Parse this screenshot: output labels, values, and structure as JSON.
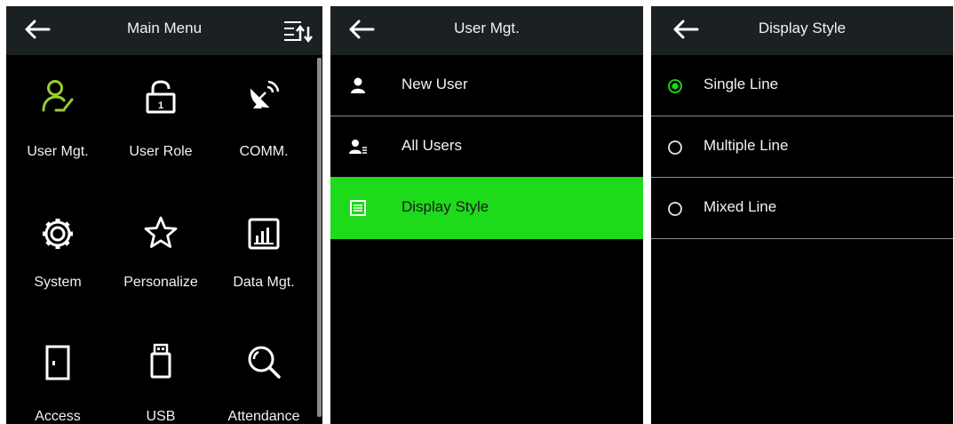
{
  "panel1": {
    "title": "Main Menu",
    "tiles": [
      {
        "label": "User Mgt."
      },
      {
        "label": "User Role"
      },
      {
        "label": "COMM."
      },
      {
        "label": "System"
      },
      {
        "label": "Personalize"
      },
      {
        "label": "Data Mgt."
      },
      {
        "label": "Access"
      },
      {
        "label": "USB"
      },
      {
        "label": "Attendance"
      }
    ]
  },
  "panel2": {
    "title": "User Mgt.",
    "items": [
      {
        "label": "New User"
      },
      {
        "label": "All Users"
      },
      {
        "label": "Display Style",
        "active": true
      }
    ]
  },
  "panel3": {
    "title": "Display Style",
    "options": [
      {
        "label": "Single Line",
        "selected": true
      },
      {
        "label": "Multiple Line",
        "selected": false
      },
      {
        "label": "Mixed Line",
        "selected": false
      }
    ]
  },
  "colors": {
    "accent_green": "#1ddb1a",
    "icon_green": "#9acd32",
    "titlebar": "#1b2022",
    "background": "#000000"
  }
}
